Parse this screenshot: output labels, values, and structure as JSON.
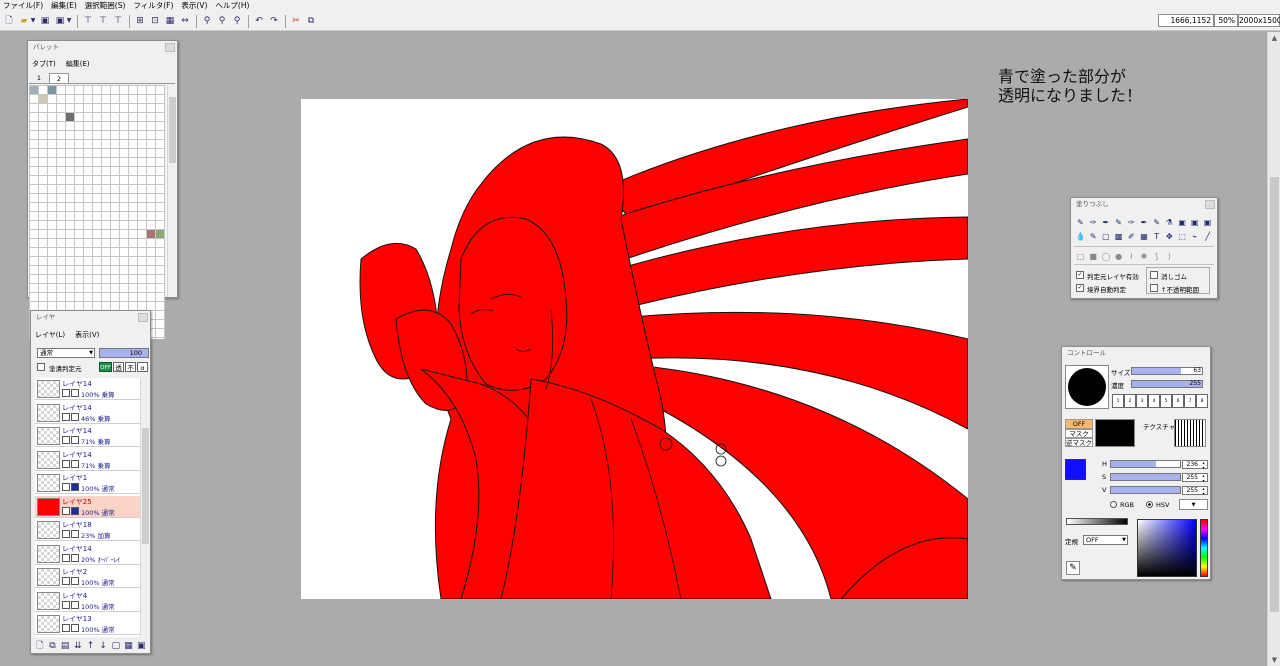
{
  "menu": [
    "ファイル(F)",
    "編集(E)",
    "選択範囲(S)",
    "フィルタ(F)",
    "表示(V)",
    "ヘルプ(H)"
  ],
  "status": {
    "coords": "1666,1152",
    "zoom": "50%",
    "size": "2000x1500"
  },
  "palette": {
    "title": "パレット",
    "menu": [
      "タブ(T)",
      "編集(E)"
    ],
    "tabs": [
      "1",
      "2"
    ],
    "swatch_colors": [
      "#9cb1bb",
      "#7c96a3",
      "#cfc9b2",
      "#6e6e6e",
      "#ad7373",
      "#8ea873"
    ]
  },
  "layers": {
    "title": "レイヤ",
    "menu": [
      "レイヤ(L)",
      "表示(V)"
    ],
    "blend_mode": "通常",
    "opacity": "100",
    "lock_label": "塗潰判定元",
    "buttons": [
      "OFF",
      "透",
      "不",
      "α"
    ],
    "items": [
      {
        "name": "レイヤ14",
        "mode": "100% 乗算"
      },
      {
        "name": "レイヤ14",
        "mode": "46% 乗算"
      },
      {
        "name": "レイヤ14",
        "mode": "71% 乗算"
      },
      {
        "name": "レイヤ14",
        "mode": "71% 乗算"
      },
      {
        "name": "レイヤ1",
        "mode": "100% 通常"
      },
      {
        "name": "レイヤ25",
        "mode": "100% 通常"
      },
      {
        "name": "レイヤ18",
        "mode": "23% 加算"
      },
      {
        "name": "レイヤ14",
        "mode": "20% ｵｰﾊﾞｰﾚｲ"
      },
      {
        "name": "レイヤ2",
        "mode": "100% 通常"
      },
      {
        "name": "レイヤ4",
        "mode": "100% 通常"
      },
      {
        "name": "レイヤ13",
        "mode": "100% 通常"
      }
    ],
    "active_index": 5
  },
  "annotation": {
    "line1": "青で塗った部分が",
    "line2": "透明になりました！"
  },
  "fill_tool": {
    "title": "塗りつぶし",
    "option1": "判定元レイヤ有効",
    "option2": "境界自動判定",
    "option3": "消しゴム",
    "option4": "↑不透明範囲"
  },
  "control": {
    "title": "コントロール",
    "size_label": "サイズ",
    "size_value": "63",
    "size_fraction": 0.7,
    "density_label": "濃度",
    "density_value": "255",
    "density_fraction": 1.0,
    "presets": [
      "1",
      "2",
      "3",
      "4",
      "5",
      "6",
      "7",
      "8"
    ],
    "mask_off": "OFF",
    "mask_label": "マスク",
    "reverse_mask_label": "逆マスク",
    "texture_label": "テクスチャ",
    "h_label": "H",
    "h_value": "236",
    "h_fraction": 0.65,
    "s_label": "S",
    "s_value": "255",
    "s_fraction": 1.0,
    "v_label": "V",
    "v_value": "255",
    "v_fraction": 1.0,
    "rgb_label": "RGB",
    "hsv_label": "HSV",
    "ruler_label": "定規",
    "ruler_value": "OFF",
    "main_color": "#1010ff"
  },
  "colors": {
    "fill_red": "#ff0000",
    "workspace": "#ababab"
  }
}
